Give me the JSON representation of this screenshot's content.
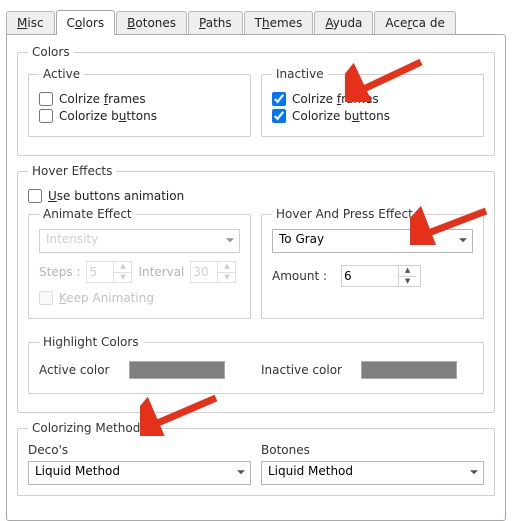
{
  "tabs": {
    "misc": "Misc",
    "colors": "Colors",
    "botones": "Botones",
    "paths": "Paths",
    "themes": "Themes",
    "ayuda": "Ayuda",
    "acerca": "Acerca de"
  },
  "colors_group": {
    "legend": "Colors",
    "active": {
      "legend": "Active",
      "colorize_frames": "Colrize frames",
      "colorize_buttons": "Colorize buttons"
    },
    "inactive": {
      "legend": "Inactive",
      "colorize_frames": "Colrize frames",
      "colorize_buttons": "Colorize buttons"
    }
  },
  "hover": {
    "legend": "Hover Effects",
    "use_anim": "Use buttons animation",
    "animate": {
      "legend": "Animate Effect",
      "intensity": "Intensity",
      "steps_label": "Steps :",
      "steps_value": "5",
      "interval_label": "Interval",
      "interval_value": "30",
      "keep": "Keep Animating"
    },
    "press": {
      "legend": "Hover And Press Effect",
      "select_value": "To Gray",
      "amount_label": "Amount :",
      "amount_value": "6"
    },
    "highlight": {
      "legend": "Highlight Colors",
      "active_label": "Active color",
      "inactive_label": "Inactive color"
    }
  },
  "method": {
    "legend": "Colorizing Method",
    "deco_label": "Deco's",
    "deco_value": "Liquid Method",
    "bot_label": "Botones",
    "bot_value": "Liquid Method"
  },
  "colors": {
    "sample": "#7f7f7f"
  }
}
